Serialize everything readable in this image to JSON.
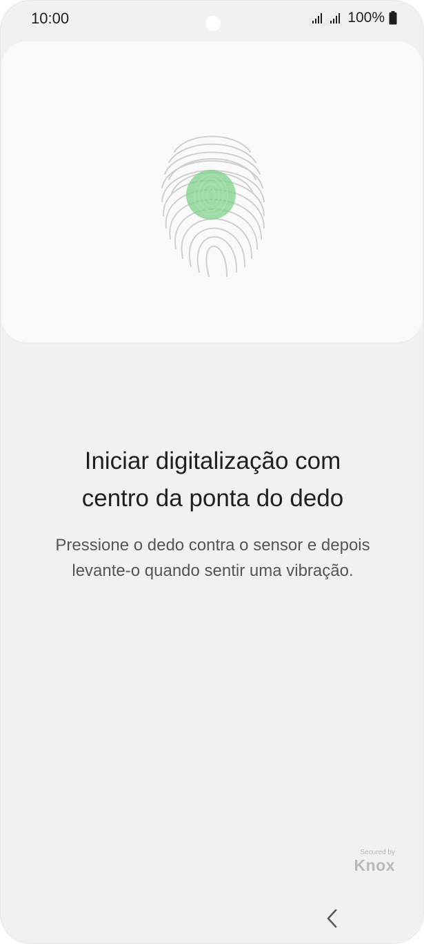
{
  "status_bar": {
    "time": "10:00",
    "battery": "100%",
    "signal_icon": "signal-bars-icon",
    "battery_icon": "battery-icon"
  },
  "illustration": {
    "icon": "fingerprint-icon",
    "accent_color": "#7fd08a"
  },
  "content": {
    "title_line1": "Iniciar digitalização com",
    "title_line2": "centro da ponta do dedo",
    "description_line1": "Pressione o dedo contra o sensor e depois",
    "description_line2": "levante-o quando sentir uma vibração."
  },
  "footer": {
    "secured_by": "Secured by",
    "brand": "Knox"
  },
  "nav": {
    "back_icon": "chevron-left-icon"
  }
}
